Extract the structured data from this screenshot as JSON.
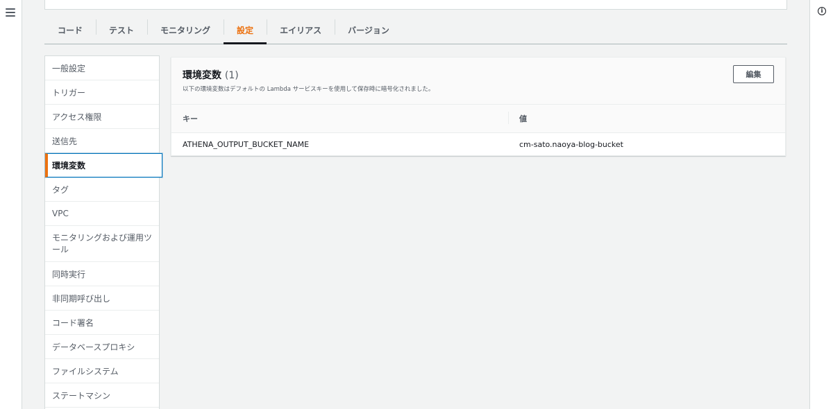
{
  "icons": {
    "menu": "hamburger-menu-icon",
    "info": "info-circle-icon"
  },
  "colors": {
    "accent": "#ec7211",
    "active_border": "#0073bb",
    "background": "#f2f3f3"
  },
  "info_glyph": "i",
  "tabs": [
    {
      "label": "コード"
    },
    {
      "label": "テスト"
    },
    {
      "label": "モニタリング"
    },
    {
      "label": "設定",
      "active": true
    },
    {
      "label": "エイリアス"
    },
    {
      "label": "バージョン"
    }
  ],
  "sidebar": {
    "items": [
      {
        "label": "一般設定"
      },
      {
        "label": "トリガー"
      },
      {
        "label": "アクセス権限"
      },
      {
        "label": "送信先"
      },
      {
        "label": "環境変数",
        "active": true
      },
      {
        "label": "タグ"
      },
      {
        "label": "VPC"
      },
      {
        "label": "モニタリングおよび運用ツール"
      },
      {
        "label": "同時実行"
      },
      {
        "label": "非同期呼び出し"
      },
      {
        "label": "コード署名"
      },
      {
        "label": "データベースプロキシ"
      },
      {
        "label": "ファイルシステム"
      },
      {
        "label": "ステートマシン"
      }
    ]
  },
  "env_panel": {
    "title": "環境変数",
    "count": "(1)",
    "description": "以下の環境変数はデフォルトの Lambda サービスキーを使用して保存時に暗号化されました。",
    "edit_label": "編集",
    "columns": {
      "key": "キー",
      "value": "値"
    },
    "rows": [
      {
        "key": "ATHENA_OUTPUT_BUCKET_NAME",
        "value": "cm-sato.naoya-blog-bucket"
      }
    ]
  }
}
